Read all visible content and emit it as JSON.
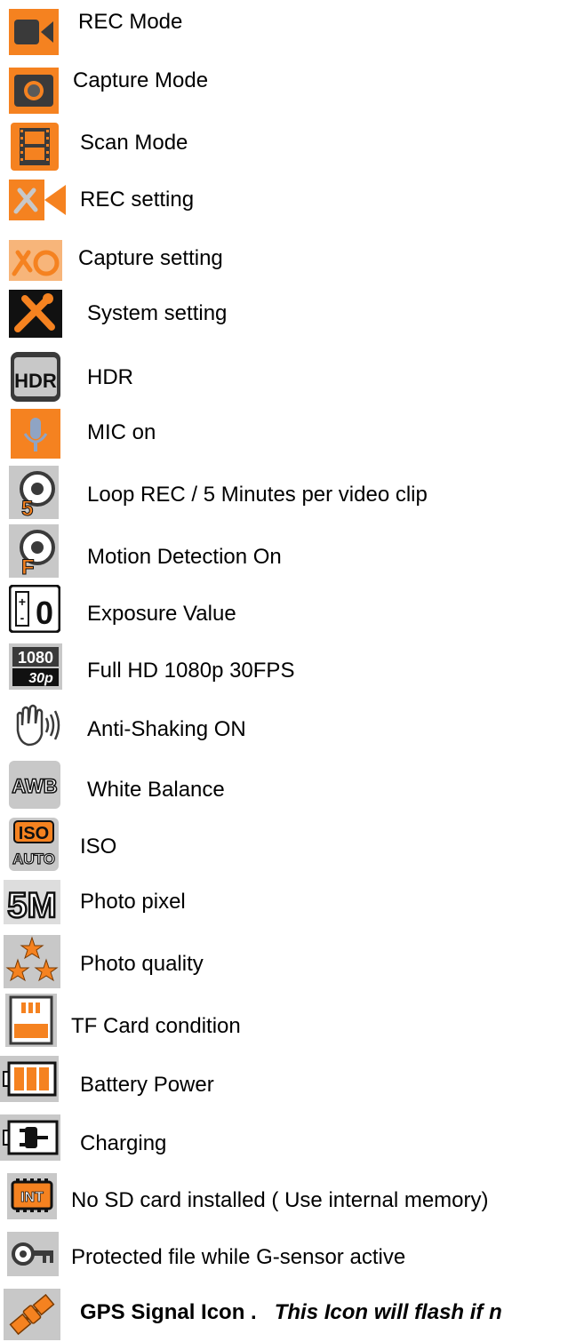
{
  "items": [
    {
      "icon": "video-camera-icon",
      "label": "REC Mode"
    },
    {
      "icon": "camera-icon",
      "label": "Capture  Mode"
    },
    {
      "icon": "film-strip-icon",
      "label": "Scan Mode"
    },
    {
      "icon": "video-settings-icon",
      "label": "REC setting"
    },
    {
      "icon": "camera-settings-icon",
      "label": "Capture setting"
    },
    {
      "icon": "tools-icon",
      "label": "System setting"
    },
    {
      "icon": "hdr-icon",
      "label": "HDR",
      "icon_text": "HDR"
    },
    {
      "icon": "microphone-icon",
      "label": "MIC on"
    },
    {
      "icon": "loop-rec-icon",
      "label": "Loop REC  / 5 Minutes per video clip",
      "icon_text": "5"
    },
    {
      "icon": "motion-detection-icon",
      "label": "Motion Detection On",
      "icon_text": "F"
    },
    {
      "icon": "exposure-icon",
      "label": "Exposure Value",
      "icon_text": "0"
    },
    {
      "icon": "resolution-icon",
      "label": "Full HD 1080p 30FPS",
      "icon_text_top": "1080",
      "icon_text_bottom": "30p"
    },
    {
      "icon": "anti-shake-hand-icon",
      "label": "Anti-Shaking ON"
    },
    {
      "icon": "white-balance-icon",
      "label": "White Balance",
      "icon_text": "AWB"
    },
    {
      "icon": "iso-icon",
      "label": "ISO",
      "icon_text_top": "ISO",
      "icon_text_bottom": "AUTO"
    },
    {
      "icon": "photo-pixel-icon",
      "label": "Photo pixel",
      "icon_text": "5M"
    },
    {
      "icon": "stars-quality-icon",
      "label": "Photo quality"
    },
    {
      "icon": "tf-card-icon",
      "label": "TF Card condition"
    },
    {
      "icon": "battery-icon",
      "label": "Battery Power"
    },
    {
      "icon": "charging-plug-icon",
      "label": "Charging"
    },
    {
      "icon": "internal-memory-icon",
      "label": "No SD card installed ( Use internal memory)",
      "icon_text": "INT"
    },
    {
      "icon": "key-icon",
      "label": "Protected file  while G-sensor active"
    },
    {
      "icon": "gps-satellite-icon",
      "label_bold": "GPS Signal Icon .",
      "label_italic": "This Icon will flash if n"
    }
  ],
  "colors": {
    "orange": "#f58220",
    "dark": "#3a3a3a",
    "gray": "#c8c8c8"
  }
}
